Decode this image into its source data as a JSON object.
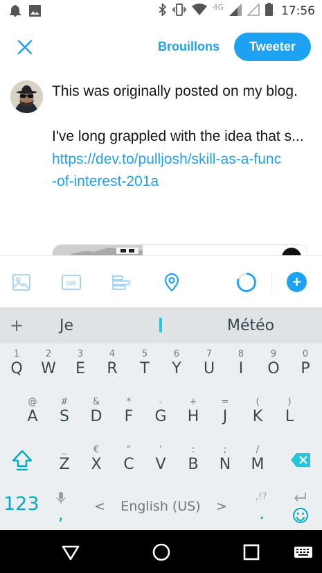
{
  "status_bar": {
    "network": "4G",
    "time": "17:56",
    "icons": [
      "notification-icon",
      "image-icon",
      "bluetooth-icon",
      "vibrate-icon",
      "wifi-icon",
      "signal-icon",
      "signal-empty-icon",
      "battery-icon"
    ]
  },
  "header": {
    "close_icon": "close-icon",
    "drafts_label": "Brouillons",
    "tweet_label": "Tweeter"
  },
  "compose": {
    "text_line1": "This was originally posted on my blog.",
    "text_line2": "I've long grappled with the idea that s...",
    "link_line1": "https://dev.to/pulljosh/skill-as-a-func",
    "link_line2": "-of-interest-201a"
  },
  "toolbar": {
    "icons": [
      "image-icon",
      "gif-icon",
      "poll-icon",
      "location-icon",
      "char-counter",
      "add-tweet-icon"
    ],
    "gif_label": "GIF",
    "add_label": "+"
  },
  "keyboard": {
    "suggestions": {
      "plus": "+",
      "left": "Je",
      "right": "Météo"
    },
    "row1": [
      {
        "hint": "1",
        "key": "Q"
      },
      {
        "hint": "2",
        "key": "W"
      },
      {
        "hint": "3",
        "key": "E"
      },
      {
        "hint": "4",
        "key": "R"
      },
      {
        "hint": "5",
        "key": "T"
      },
      {
        "hint": "6",
        "key": "Y"
      },
      {
        "hint": "7",
        "key": "U"
      },
      {
        "hint": "8",
        "key": "I"
      },
      {
        "hint": "9",
        "key": "O"
      },
      {
        "hint": "0",
        "key": "P"
      }
    ],
    "row2": [
      {
        "hint": "@",
        "key": "A"
      },
      {
        "hint": "#",
        "key": "S"
      },
      {
        "hint": "&",
        "key": "D"
      },
      {
        "hint": "*",
        "key": "F"
      },
      {
        "hint": "-",
        "key": "G"
      },
      {
        "hint": "+",
        "key": "H"
      },
      {
        "hint": "=",
        "key": "J"
      },
      {
        "hint": "(",
        "key": "K"
      },
      {
        "hint": ")",
        "key": "L"
      }
    ],
    "row3": [
      {
        "hint": "_",
        "key": "Z"
      },
      {
        "hint": "€",
        "key": "X"
      },
      {
        "hint": "\"",
        "key": "C"
      },
      {
        "hint": "'",
        "key": "V"
      },
      {
        "hint": ":",
        "key": "B"
      },
      {
        "hint": ";",
        "key": "N"
      },
      {
        "hint": "/",
        "key": "M"
      }
    ],
    "numbers_label": "123",
    "comma_label": ",",
    "space_label": "English (US)",
    "space_left": "<",
    "space_right": ">",
    "period_hint": ",!?",
    "period_label": ".",
    "accent_color": "#00acc1"
  },
  "nav_bar": {
    "icons": [
      "back-icon",
      "home-icon",
      "recents-icon",
      "keyboard-switch-icon"
    ]
  },
  "colors": {
    "brand": "#1da1f2",
    "text": "#14171a",
    "keyboard_bg": "#eceff1"
  }
}
